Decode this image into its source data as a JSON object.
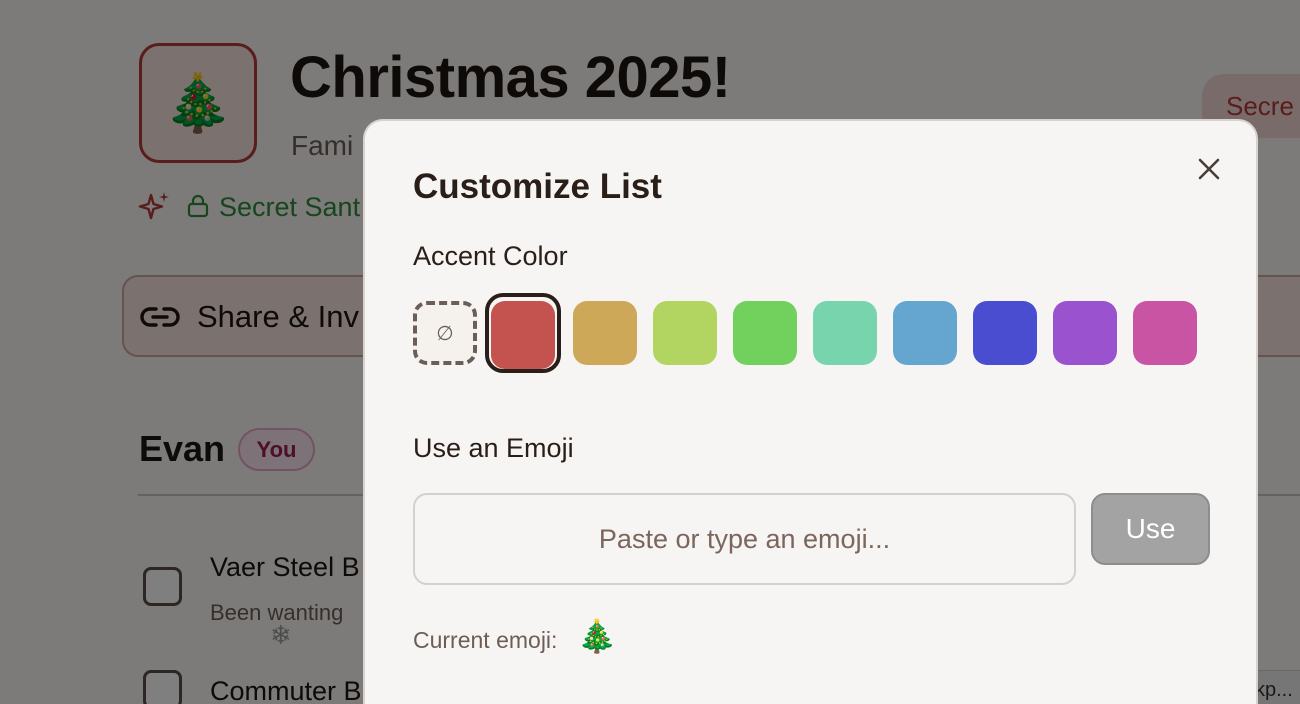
{
  "list": {
    "emoji": "🎄",
    "title": "Christmas 2025!",
    "subtitle": "Fami",
    "secret_pill": "Secre",
    "secret_status": "Secret Sant",
    "share_label": "Share & Inv"
  },
  "member": {
    "name": "Evan",
    "badge": "You"
  },
  "items": [
    {
      "title": "Vaer Steel B",
      "note": "Been wanting"
    },
    {
      "title": "Commuter B",
      "note": ""
    }
  ],
  "url_chip": "kp...",
  "modal": {
    "title": "Customize List",
    "accent_label": "Accent Color",
    "none_symbol": "∅",
    "swatches": [
      "#c4524e",
      "#cda858",
      "#b2d461",
      "#72d05c",
      "#77d4ad",
      "#65a6d0",
      "#4b4dd0",
      "#9a52cf",
      "#c954a4"
    ],
    "selected_swatch": "#c4524e",
    "emoji_label": "Use an Emoji",
    "emoji_placeholder": "Paste or type an emoji...",
    "use_button": "Use",
    "current_emoji_label": "Current emoji:",
    "current_emoji": "🎄"
  },
  "icons": [
    "sparkle-icon",
    "lock-icon",
    "link-icon",
    "close-icon",
    "snowflake-icon"
  ]
}
